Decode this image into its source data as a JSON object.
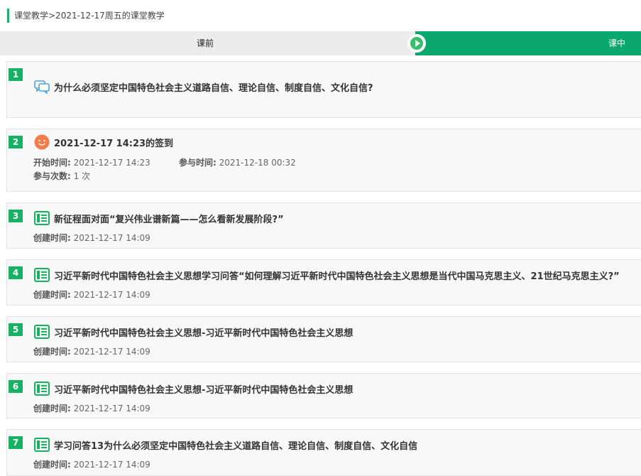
{
  "breadcrumb": "课堂教学>2021-12-17周五的课堂教学",
  "stages": {
    "before": "课前",
    "during": "课中"
  },
  "cards": [
    {
      "num": "1",
      "icon": "discussion-icon",
      "title": "为什么必须坚定中国特色社会主义道路自信、理论自信、制度自信、文化自信?"
    },
    {
      "num": "2",
      "icon": "checkin-smiley-icon",
      "title": "2021-12-17 14:23的签到",
      "start_key": "开始时间:",
      "start_val": "2021-12-17 14:23",
      "join_key": "参与时间:",
      "join_val": "2021-12-18 00:32",
      "count_key": "参与次数:",
      "count_val": "1 次"
    },
    {
      "num": "3",
      "icon": "book-icon",
      "title": "新征程面对面“复兴伟业谱新篇——怎么看新发展阶段?”",
      "created_key": "创建时间:",
      "created_val": "2021-12-17 14:09"
    },
    {
      "num": "4",
      "icon": "book-icon",
      "title": "习近平新时代中国特色社会主义思想学习问答“如何理解习近平新时代中国特色社会主义思想是当代中国马克思主义、21世纪马克思主义?”",
      "created_key": "创建时间:",
      "created_val": "2021-12-17 14:09"
    },
    {
      "num": "5",
      "icon": "book-icon",
      "title": "习近平新时代中国特色社会主义思想-习近平新时代中国特色社会主义思想",
      "created_key": "创建时间:",
      "created_val": "2021-12-17 14:09"
    },
    {
      "num": "6",
      "icon": "book-icon",
      "title": "习近平新时代中国特色社会主义思想-习近平新时代中国特色社会主义思想",
      "created_key": "创建时间:",
      "created_val": "2021-12-17 14:09"
    },
    {
      "num": "7",
      "icon": "book-icon",
      "title": "学习问答13为什么必须坚定中国特色社会主义道路自信、理论自信、制度自信、文化自信",
      "created_key": "创建时间:",
      "created_val": "2021-12-17 14:09"
    }
  ],
  "colors": {
    "accent": "#0aa870",
    "badge": "#14b262"
  }
}
